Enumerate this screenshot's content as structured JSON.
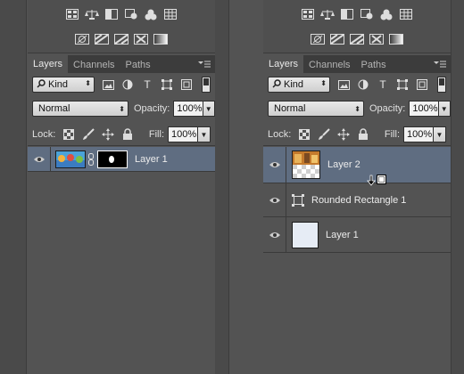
{
  "left_panel": {
    "tabs": [
      "Layers",
      "Channels",
      "Paths"
    ],
    "filter": {
      "kind": "Kind"
    },
    "blend_mode": "Normal",
    "opacity_label": "Opacity:",
    "opacity_value": "100%",
    "lock_label": "Lock:",
    "fill_label": "Fill:",
    "fill_value": "100%",
    "layers": [
      {
        "name": "Layer 1",
        "selected": true
      }
    ]
  },
  "right_panel": {
    "tabs": [
      "Layers",
      "Channels",
      "Paths"
    ],
    "filter": {
      "kind": "Kind"
    },
    "blend_mode": "Normal",
    "opacity_label": "Opacity:",
    "opacity_value": "100%",
    "lock_label": "Lock:",
    "fill_label": "Fill:",
    "fill_value": "100%",
    "layers": [
      {
        "name": "Layer 2",
        "selected": true
      },
      {
        "name": "Rounded Rectangle 1",
        "selected": false
      },
      {
        "name": "Layer 1",
        "selected": false
      }
    ]
  },
  "colors": {
    "panel_bg": "#535353",
    "selected_row": "#5f6d81",
    "tab_bar": "#3c3c3c"
  }
}
